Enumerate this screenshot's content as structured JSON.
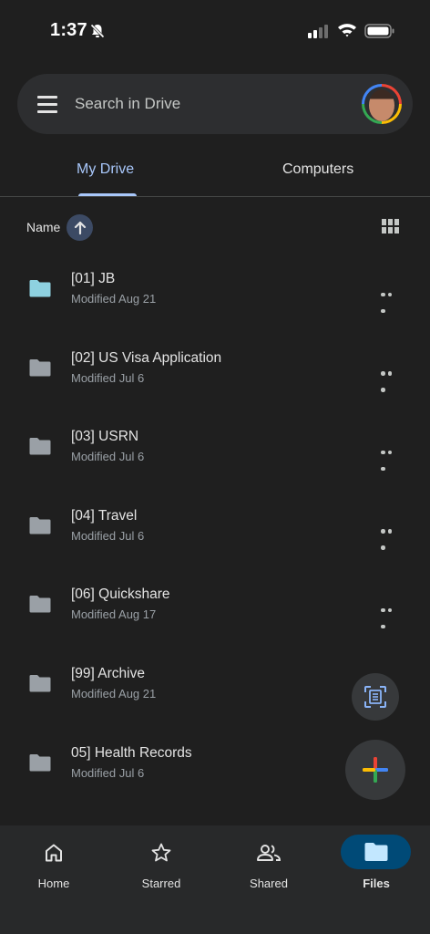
{
  "status_bar": {
    "time": "1:37"
  },
  "search": {
    "placeholder": "Search in Drive"
  },
  "tabs": [
    {
      "label": "My Drive",
      "active": true
    },
    {
      "label": "Computers",
      "active": false
    }
  ],
  "sort": {
    "label": "Name",
    "direction": "ascending"
  },
  "files": [
    {
      "name": "[01] JB",
      "meta": "Modified Aug 21",
      "folder_color": "#8ed1e0"
    },
    {
      "name": "[02] US Visa Application",
      "meta": "Modified Jul 6",
      "folder_color": "#9aa0a6"
    },
    {
      "name": "[03] USRN",
      "meta": "Modified Jul 6",
      "folder_color": "#9aa0a6"
    },
    {
      "name": "[04] Travel",
      "meta": "Modified Jul 6",
      "folder_color": "#9aa0a6"
    },
    {
      "name": "[06] Quickshare",
      "meta": "Modified Aug 17",
      "folder_color": "#9aa0a6"
    },
    {
      "name": "[99] Archive",
      "meta": "Modified Aug 21",
      "folder_color": "#9aa0a6"
    },
    {
      "name": "05] Health Records",
      "meta": "Modified Jul 6",
      "folder_color": "#9aa0a6"
    }
  ],
  "bottom_nav": [
    {
      "label": "Home",
      "icon": "home-icon"
    },
    {
      "label": "Starred",
      "icon": "star-icon"
    },
    {
      "label": "Shared",
      "icon": "shared-icon"
    },
    {
      "label": "Files",
      "icon": "folder-icon",
      "active": true
    }
  ],
  "colors": {
    "background": "#1f1f1f",
    "accent": "#a8c7fa",
    "active_nav_pill": "#004a77",
    "search_bar": "#2d2e30"
  }
}
